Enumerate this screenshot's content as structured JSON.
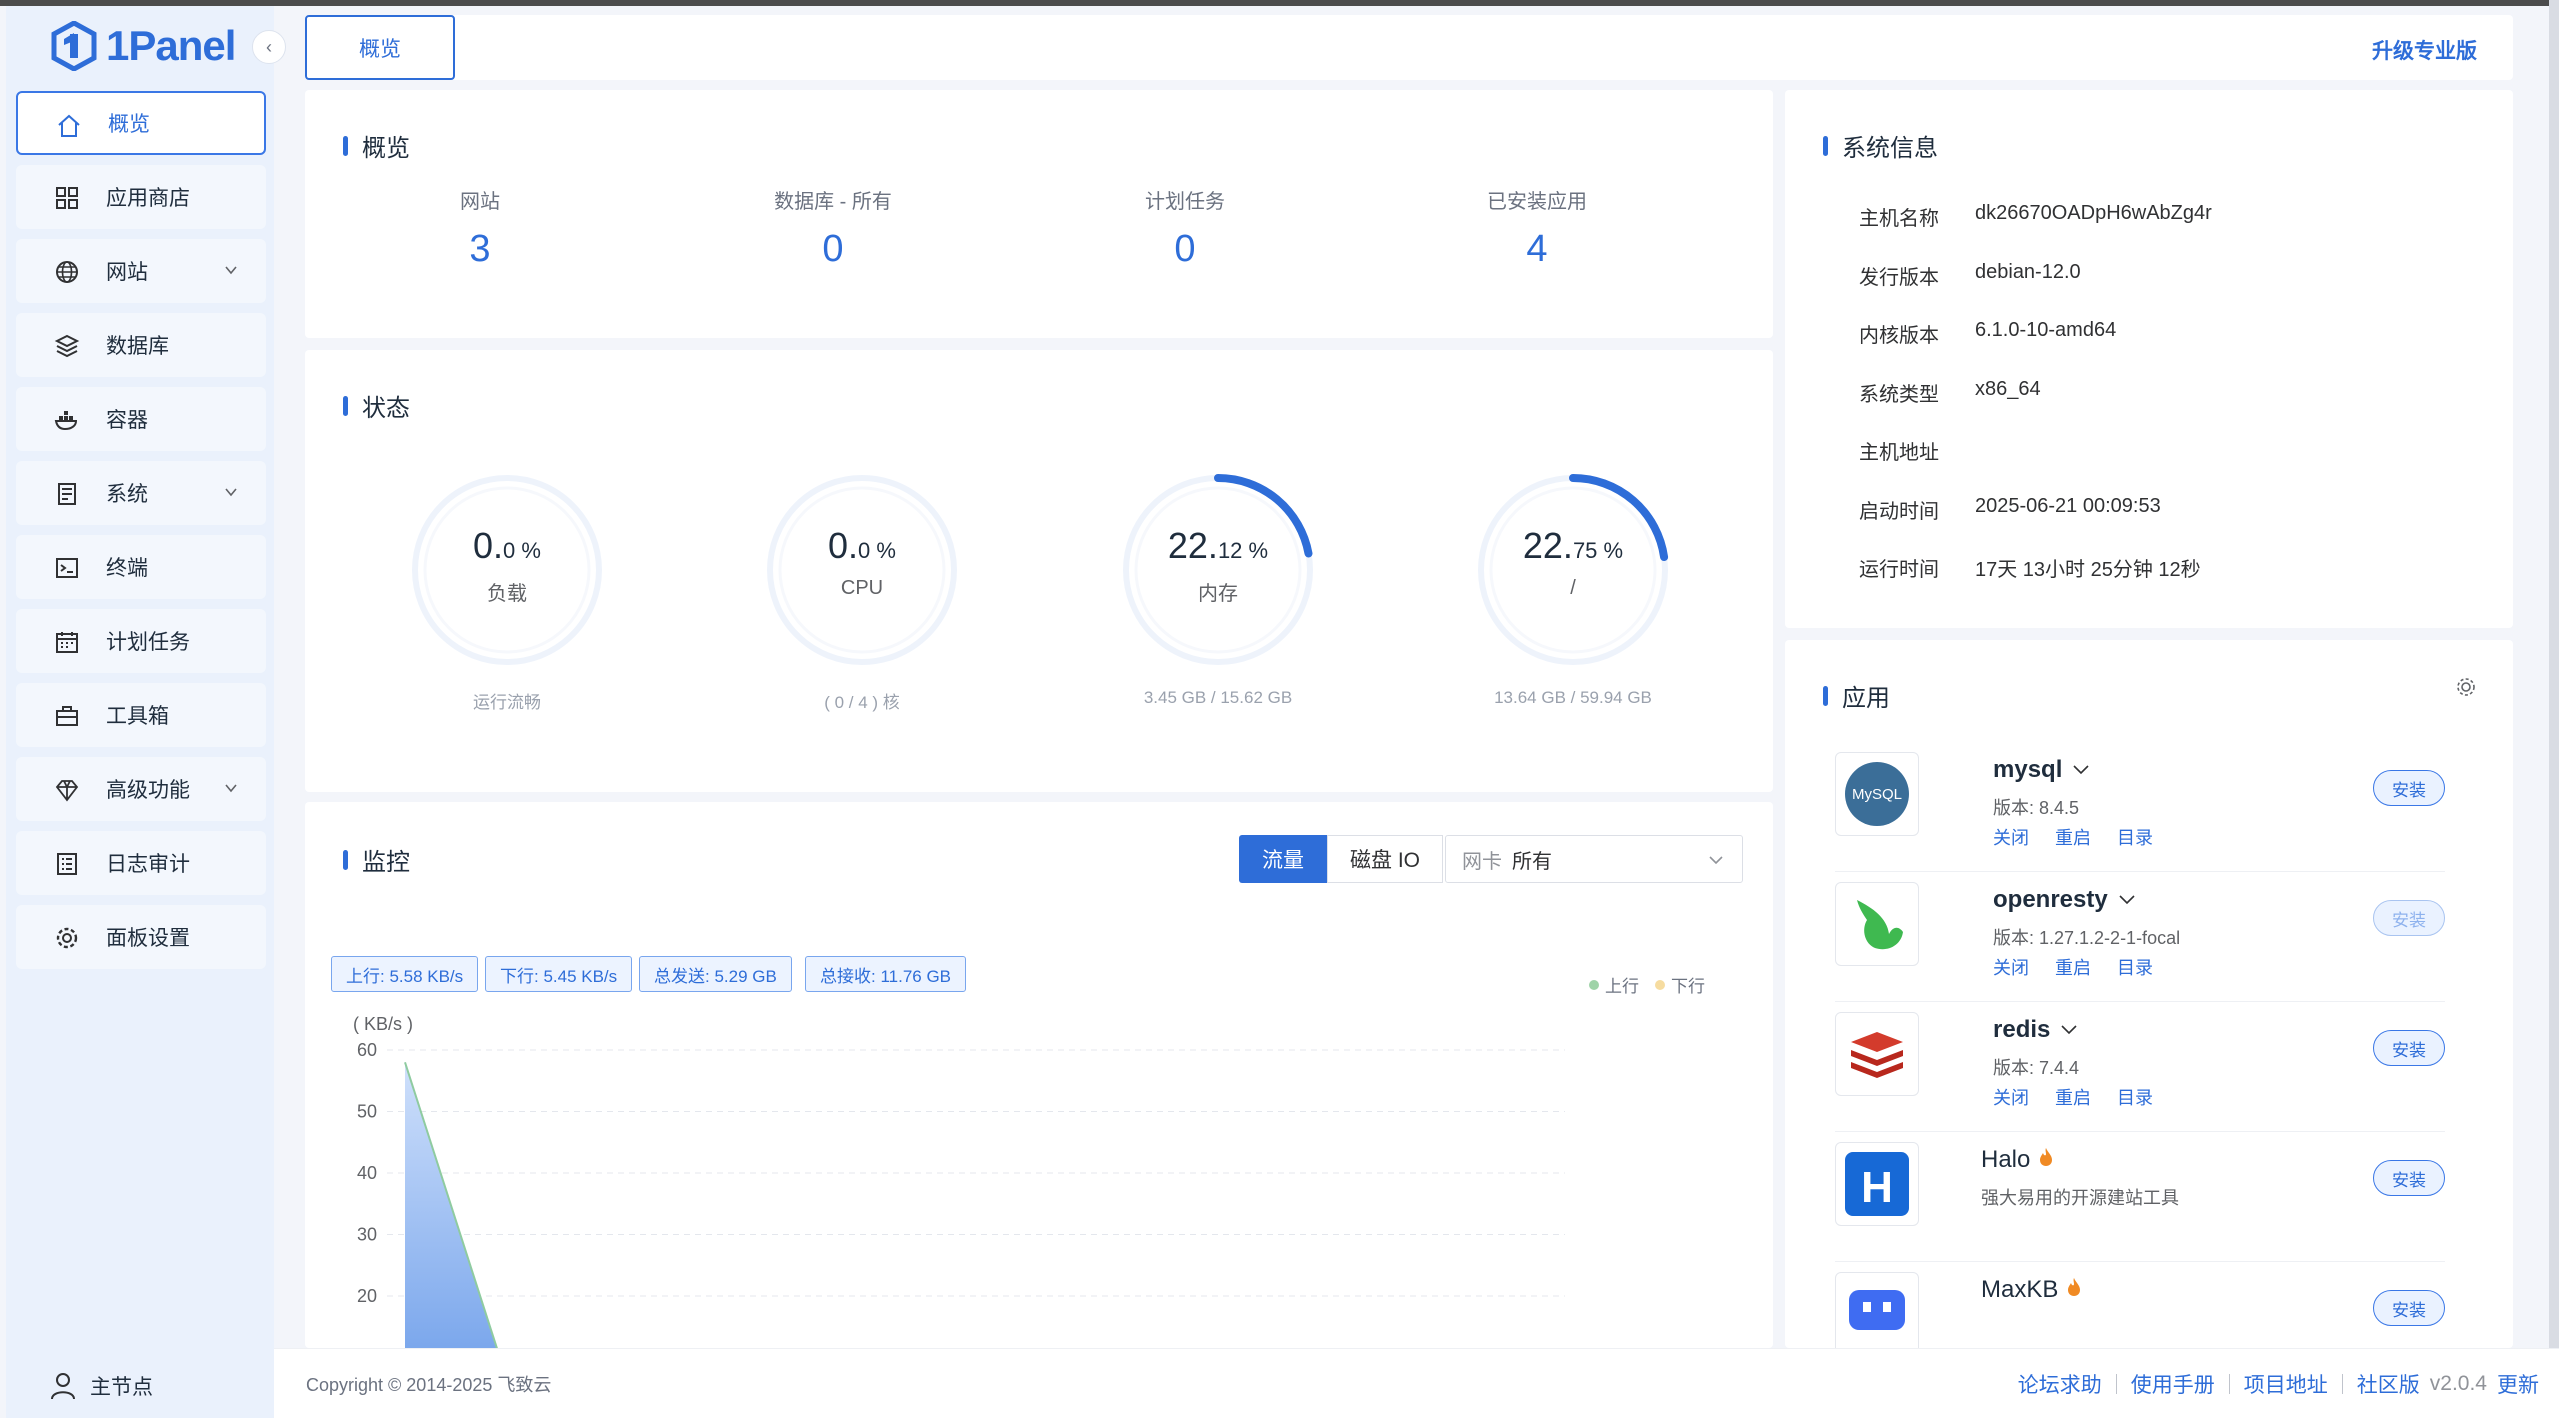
{
  "brand": {
    "name": "1Panel",
    "color": "#2e6dd8"
  },
  "sidebar": {
    "items": [
      {
        "label": "概览",
        "icon": "home-icon",
        "active": true
      },
      {
        "label": "应用商店",
        "icon": "grid-icon"
      },
      {
        "label": "网站",
        "icon": "globe-icon",
        "expandable": true
      },
      {
        "label": "数据库",
        "icon": "layers-icon"
      },
      {
        "label": "容器",
        "icon": "docker-icon"
      },
      {
        "label": "系统",
        "icon": "server-icon",
        "expandable": true
      },
      {
        "label": "终端",
        "icon": "terminal-icon"
      },
      {
        "label": "计划任务",
        "icon": "calendar-icon"
      },
      {
        "label": "工具箱",
        "icon": "toolbox-icon"
      },
      {
        "label": "高级功能",
        "icon": "diamond-icon",
        "expandable": true
      },
      {
        "label": "日志审计",
        "icon": "log-icon"
      },
      {
        "label": "面板设置",
        "icon": "gear-icon"
      }
    ],
    "footer_label": "主节点"
  },
  "header": {
    "tab_label": "概览",
    "upgrade_label": "升级专业版"
  },
  "overview": {
    "title": "概览",
    "stats": [
      {
        "label": "网站",
        "value": "3"
      },
      {
        "label": "数据库 - 所有",
        "value": "0"
      },
      {
        "label": "计划任务",
        "value": "0"
      },
      {
        "label": "已安装应用",
        "value": "4"
      }
    ]
  },
  "status": {
    "title": "状态",
    "gauges": [
      {
        "int": "0.",
        "dec": "0",
        "unit": " %",
        "name": "负载",
        "sub": "运行流畅",
        "percent": 0
      },
      {
        "int": "0.",
        "dec": "0",
        "unit": " %",
        "name": "CPU",
        "sub": "( 0 / 4 ) 核",
        "percent": 0
      },
      {
        "int": "22.",
        "dec": "12",
        "unit": " %",
        "name": "内存",
        "sub": "3.45 GB / 15.62 GB",
        "percent": 22.12
      },
      {
        "int": "22.",
        "dec": "75",
        "unit": " %",
        "name": "/",
        "sub": "13.64 GB / 59.94 GB",
        "percent": 22.75
      }
    ]
  },
  "sysinfo": {
    "title": "系统信息",
    "rows": [
      {
        "k": "主机名称",
        "v": "dk26670OADpH6wAbZg4r"
      },
      {
        "k": "发行版本",
        "v": "debian-12.0"
      },
      {
        "k": "内核版本",
        "v": "6.1.0-10-amd64"
      },
      {
        "k": "系统类型",
        "v": "x86_64"
      },
      {
        "k": "主机地址",
        "v": ""
      },
      {
        "k": "启动时间",
        "v": "2025-06-21 00:09:53"
      },
      {
        "k": "运行时间",
        "v": "17天 13小时 25分钟 12秒"
      }
    ]
  },
  "apps": {
    "title": "应用",
    "items": [
      {
        "name": "mysql",
        "version": "版本: 8.4.5",
        "actions": [
          "关闭",
          "重启",
          "目录"
        ],
        "button": "安装"
      },
      {
        "name": "openresty",
        "version": "版本: 1.27.1.2-2-1-focal",
        "actions": [
          "关闭",
          "重启",
          "目录"
        ],
        "button": "安装"
      },
      {
        "name": "redis",
        "version": "版本: 7.4.4",
        "actions": [
          "关闭",
          "重启",
          "目录"
        ],
        "button": "安装"
      },
      {
        "name": "Halo",
        "version": "强大易用的开源建站工具",
        "button": "安装"
      },
      {
        "name": "MaxKB",
        "version": "",
        "button": "安装"
      }
    ]
  },
  "monitor": {
    "title": "监控",
    "seg_on": "流量",
    "seg_off": "磁盘 IO",
    "nic_label": "网卡",
    "nic_value": "所有",
    "tags": [
      "上行: 5.58 KB/s",
      "下行: 5.45 KB/s",
      "总发送: 5.29 GB",
      "总接收: 11.76 GB"
    ],
    "legend": [
      {
        "label": "上行",
        "color": "#9fd3a8"
      },
      {
        "label": "下行",
        "color": "#f6dca0"
      }
    ]
  },
  "chart_data": {
    "type": "area",
    "ylabel": "( KB/s )",
    "yticks": [
      "60",
      "50",
      "40",
      "30",
      "20"
    ],
    "ylim": [
      0,
      60
    ],
    "series": [
      {
        "name": "上行",
        "values": [
          58,
          0
        ]
      }
    ]
  },
  "footer": {
    "copyright": "Copyright © 2014-2025 飞致云",
    "links": [
      "论坛求助",
      "使用手册",
      "项目地址",
      "社区版"
    ],
    "version": "v2.0.4",
    "update": "更新"
  }
}
